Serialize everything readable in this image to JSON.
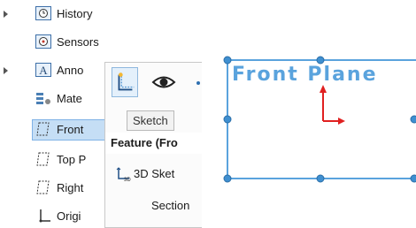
{
  "tree": {
    "items": [
      {
        "label": "History",
        "icon": "history-icon",
        "expandable": true
      },
      {
        "label": "Sensors",
        "icon": "sensors-icon",
        "expandable": false
      },
      {
        "label": "Anno",
        "icon": "annotations-icon",
        "expandable": true
      },
      {
        "label": "Mate",
        "icon": "material-icon",
        "expandable": false
      },
      {
        "label": "Front",
        "icon": "plane-icon",
        "expandable": false,
        "selected": true
      },
      {
        "label": "Top P",
        "icon": "plane-icon",
        "expandable": false
      },
      {
        "label": "Right",
        "icon": "plane-icon",
        "expandable": false
      },
      {
        "label": "Origi",
        "icon": "origin-icon",
        "expandable": false
      }
    ]
  },
  "context_toolbar": {
    "buttons": [
      {
        "icon": "sketch-icon",
        "active": true
      },
      {
        "icon": "eye-icon",
        "active": false
      }
    ],
    "tooltip": "Sketch"
  },
  "context_menu": {
    "header": "Feature (Fro",
    "items": [
      {
        "label": "3D Sket",
        "icon": "3d-sketch-icon"
      },
      {
        "label": "Section",
        "icon": ""
      }
    ]
  },
  "viewport": {
    "plane_label": "Front Plane",
    "plane_color": "#5aa3dd",
    "axis_color": "#e02020"
  }
}
